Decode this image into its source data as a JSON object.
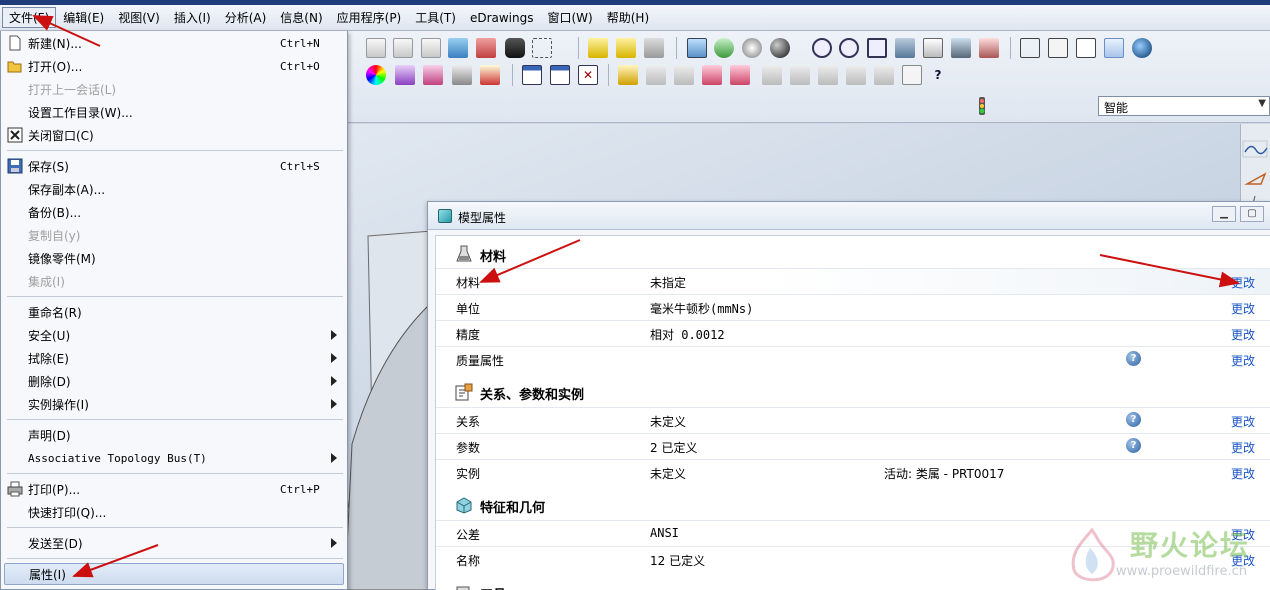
{
  "menubar": {
    "items": [
      "文件(F)",
      "编辑(E)",
      "视图(V)",
      "插入(I)",
      "分析(A)",
      "信息(N)",
      "应用程序(P)",
      "工具(T)",
      "eDrawings",
      "窗口(W)",
      "帮助(H)"
    ]
  },
  "toolbar": {
    "smart_filter": "智能"
  },
  "file_menu": {
    "new": {
      "label": "新建(N)...",
      "shortcut": "Ctrl+N"
    },
    "open": {
      "label": "打开(O)...",
      "shortcut": "Ctrl+O"
    },
    "open_session": {
      "label": "打开上一会话(L)"
    },
    "set_working_dir": {
      "label": "设置工作目录(W)..."
    },
    "close_window": {
      "label": "关闭窗口(C)"
    },
    "save": {
      "label": "保存(S)",
      "shortcut": "Ctrl+S"
    },
    "save_copy": {
      "label": "保存副本(A)..."
    },
    "backup": {
      "label": "备份(B)..."
    },
    "copy_from": {
      "label": "复制自(y)"
    },
    "mirror_part": {
      "label": "镜像零件(M)"
    },
    "integrate": {
      "label": "集成(I)"
    },
    "rename": {
      "label": "重命名(R)"
    },
    "security": {
      "label": "安全(U)"
    },
    "erase": {
      "label": "拭除(E)"
    },
    "delete": {
      "label": "删除(D)"
    },
    "instance_ops": {
      "label": "实例操作(I)"
    },
    "declare": {
      "label": "声明(D)"
    },
    "topology_bus": {
      "label": "Associative Topology Bus(T)"
    },
    "print": {
      "label": "打印(P)...",
      "shortcut": "Ctrl+P"
    },
    "quick_print": {
      "label": "快速打印(Q)..."
    },
    "send_to": {
      "label": "发送至(D)"
    },
    "properties": {
      "label": "属性(I)"
    }
  },
  "dialog": {
    "title": "模型属性",
    "sections": {
      "material": {
        "title": "材料",
        "rows": [
          {
            "label": "材料",
            "value": "未指定",
            "action": "更改"
          },
          {
            "label": "单位",
            "value": "毫米牛顿秒(mmNs)",
            "action": "更改"
          },
          {
            "label": "精度",
            "value": "相对 0.0012",
            "action": "更改"
          },
          {
            "label": "质量属性",
            "value": "",
            "action": "更改"
          }
        ]
      },
      "relations": {
        "title": "关系、参数和实例",
        "rows": [
          {
            "label": "关系",
            "value": "未定义",
            "action": "更改"
          },
          {
            "label": "参数",
            "value": "2 已定义",
            "action": "更改"
          },
          {
            "label": "实例",
            "value": "未定义",
            "extra": "活动: 类属 - PRT0017",
            "action": "更改"
          }
        ]
      },
      "features": {
        "title": "特征和几何",
        "rows": [
          {
            "label": "公差",
            "value": "ANSI",
            "action": "更改"
          },
          {
            "label": "名称",
            "value": "12 已定义",
            "action": "更改"
          }
        ]
      },
      "tools": {
        "title": "工具"
      }
    }
  },
  "watermark": {
    "text": "野火论坛",
    "url": "www.proewildfire.cn"
  },
  "colors": {
    "link": "#1a55c9",
    "arrow": "#cc1010",
    "highlight": "#cfdcf0"
  }
}
